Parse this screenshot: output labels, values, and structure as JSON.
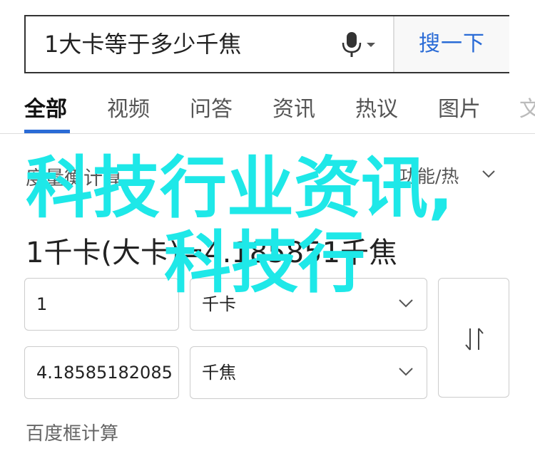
{
  "search": {
    "query": "1大卡等于多少千焦",
    "button_label": "搜一下",
    "icons": {
      "mic": "microphone-icon",
      "caret": "caret-down-icon"
    }
  },
  "tabs": [
    {
      "label": "全部",
      "active": true
    },
    {
      "label": "视频"
    },
    {
      "label": "问答"
    },
    {
      "label": "资讯"
    },
    {
      "label": "热议"
    },
    {
      "label": "图片"
    },
    {
      "label": "文"
    }
  ],
  "converter": {
    "title": "度量衡计算",
    "category": "功能/热",
    "result": "1千卡(大卡)=4.185851千焦",
    "from": {
      "value": "1",
      "unit": "千卡"
    },
    "to": {
      "value": "4.18585182085",
      "unit": "千焦"
    },
    "footer": "百度框计算"
  },
  "watermark": {
    "line1": "科技行业资讯,",
    "line2": "科技行"
  },
  "colors": {
    "accent": "#2a6bd6",
    "watermark": "#1ee8e8"
  }
}
